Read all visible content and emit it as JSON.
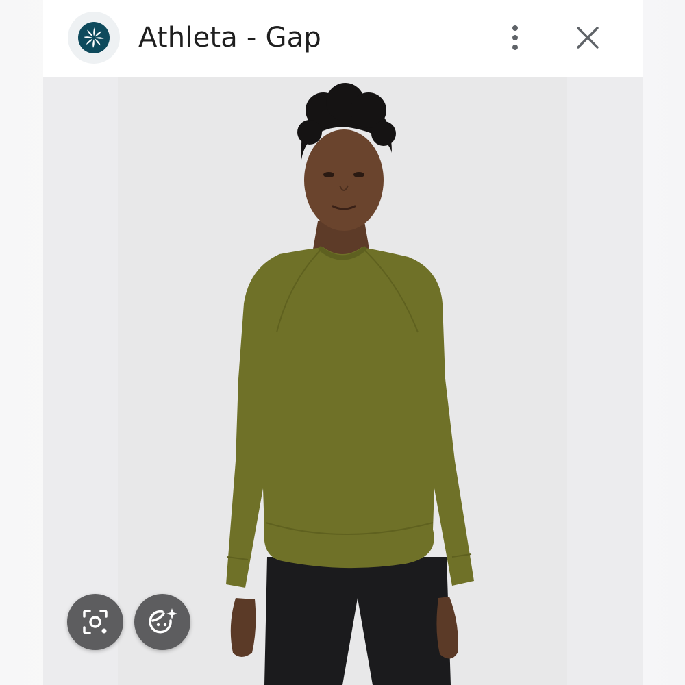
{
  "header": {
    "title": "Athleta - Gap",
    "site_icon": "athleta-logo-icon",
    "menu_icon": "more-vert-icon",
    "close_icon": "close-icon"
  },
  "photo": {
    "subject": "product-photo",
    "garment_color": "#6f7128"
  },
  "actions": {
    "lens_icon": "lens-search-icon",
    "face_icon": "face-sparkle-icon"
  },
  "colors": {
    "header_bg": "#ffffff",
    "logo_bg": "#0e4a5c",
    "fab_bg": "#5d5d5f"
  }
}
